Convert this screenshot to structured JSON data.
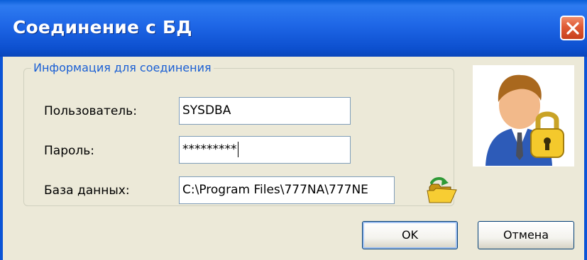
{
  "window": {
    "title": "Соединение с БД",
    "close_icon": "close-icon"
  },
  "group": {
    "legend": "Информация для соединения"
  },
  "fields": {
    "user": {
      "label": "Пользователь:",
      "value": "SYSDBA"
    },
    "password": {
      "label": "Пароль:",
      "value": "*********"
    },
    "database": {
      "label": "База данных:",
      "value": "C:\\Program Files\\777NA\\777NE"
    }
  },
  "icons": {
    "browse": "folder-open-icon",
    "avatar": "user-lock-icon"
  },
  "buttons": {
    "ok": "OK",
    "cancel": "Отмена"
  },
  "colors": {
    "titlebar": "#0a5fd8",
    "close": "#df5a34",
    "dialog_bg": "#ece9d8",
    "legend": "#1a5fd4"
  }
}
